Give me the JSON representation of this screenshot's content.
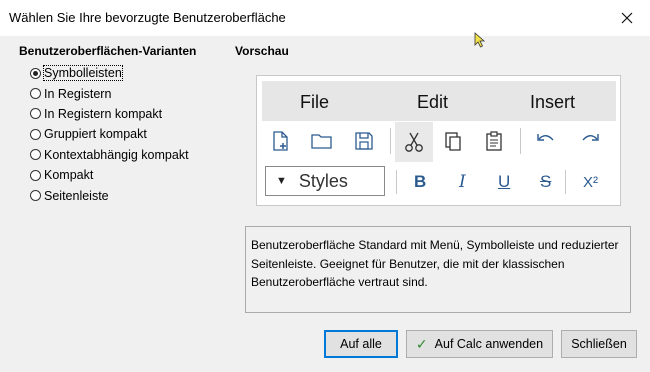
{
  "window": {
    "title": "Wählen Sie Ihre bevorzugte Benutzeroberfläche"
  },
  "variants": {
    "heading": "Benutzeroberflächen-Varianten",
    "items": [
      {
        "label": "Symbolleisten",
        "checked": true
      },
      {
        "label": "In Registern",
        "checked": false
      },
      {
        "label": "In Registern kompakt",
        "checked": false
      },
      {
        "label": "Gruppiert kompakt",
        "checked": false
      },
      {
        "label": "Kontextabhängig kompakt",
        "checked": false
      },
      {
        "label": "Kompakt",
        "checked": false
      },
      {
        "label": "Seitenleiste",
        "checked": false
      }
    ]
  },
  "preview": {
    "heading": "Vorschau",
    "menu": [
      "File",
      "Edit",
      "Insert"
    ],
    "styles_label": "Styles",
    "format": {
      "bold": "B",
      "italic": "I",
      "underline": "U",
      "strike": "S",
      "superscript": "X²"
    },
    "toolbar_icons": [
      "new-document-icon",
      "open-folder-icon",
      "save-icon",
      "cut-icon",
      "copy-icon",
      "paste-icon",
      "undo-icon",
      "redo-icon"
    ]
  },
  "description": "Benutzeroberfläche Standard mit Menü, Symbolleiste und reduzierter Seitenleiste. Geeignet für Benutzer, die mit der klassischen Benutzeroberfläche vertraut sind.",
  "buttons": {
    "apply_all": "Auf alle",
    "apply_calc": "Auf Calc anwenden",
    "close": "Schließen"
  },
  "colors": {
    "accent": "#0078d7",
    "check": "#2e8b2e",
    "format_blue": "#2b5b8f"
  }
}
